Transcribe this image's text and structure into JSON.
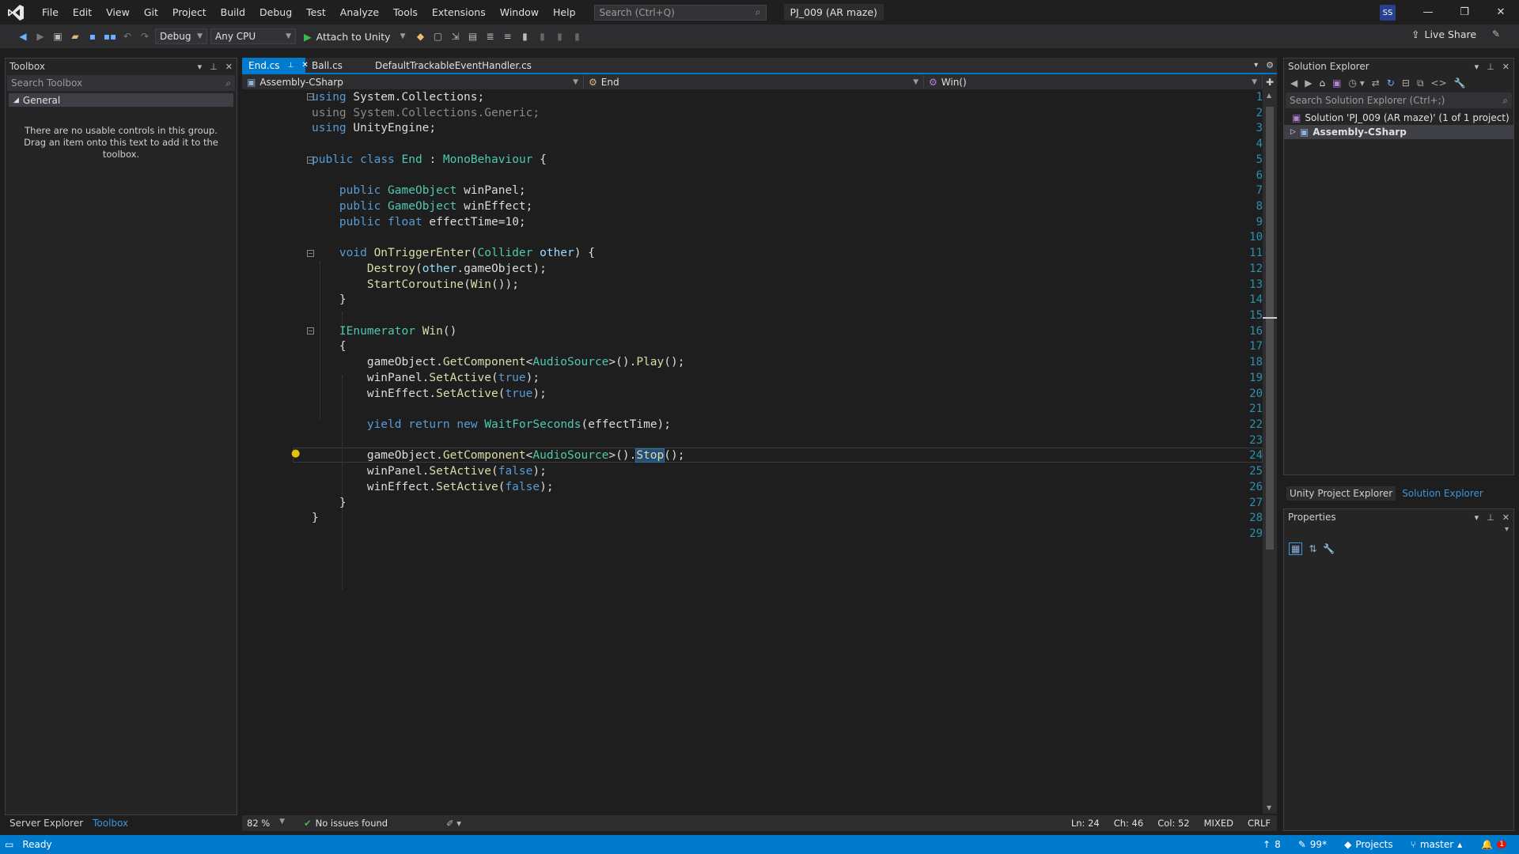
{
  "menu": [
    "File",
    "Edit",
    "View",
    "Git",
    "Project",
    "Build",
    "Debug",
    "Test",
    "Analyze",
    "Tools",
    "Extensions",
    "Window",
    "Help"
  ],
  "search": {
    "placeholder": "Search (Ctrl+Q)"
  },
  "solution_name": "PJ_009 (AR maze)",
  "user_initials": "SS",
  "toolbar": {
    "config": "Debug",
    "platform": "Any CPU",
    "attach": "Attach to Unity",
    "live_share": "Live Share"
  },
  "toolbox": {
    "title": "Toolbox",
    "search_placeholder": "Search Toolbox",
    "group": "General",
    "empty_message": "There are no usable controls in this group. Drag an item onto this text to add it to the toolbox."
  },
  "left_tabs": {
    "server_explorer": "Server Explorer",
    "toolbox": "Toolbox"
  },
  "editor": {
    "tabs": [
      {
        "label": "End.cs",
        "active": true
      },
      {
        "label": "Ball.cs",
        "active": false
      },
      {
        "label": "DefaultTrackableEventHandler.cs",
        "active": false
      }
    ],
    "nav": {
      "project": "Assembly-CSharp",
      "type": "End",
      "member": "Win()"
    },
    "zoom": "82 %",
    "issues": "No issues found",
    "position": {
      "ln": "Ln: 24",
      "ch": "Ch: 46",
      "col": "Col: 52",
      "mode": "MIXED",
      "eol": "CRLF"
    }
  },
  "solution_explorer": {
    "title": "Solution Explorer",
    "search_placeholder": "Search Solution Explorer (Ctrl+;)",
    "solution_row": "Solution 'PJ_009 (AR maze)' (1 of 1 project)",
    "project_row": "Assembly-CSharp"
  },
  "right_tabs": {
    "unity": "Unity Project Explorer",
    "solution": "Solution Explorer"
  },
  "properties": {
    "title": "Properties"
  },
  "statusbar": {
    "ready": "Ready",
    "up_count": "8",
    "pen_count": "99*",
    "projects": "Projects",
    "branch": "master",
    "notifications": "1"
  },
  "colors": {
    "accent": "#007acc",
    "keyword": "#569cd6",
    "type": "#4ec9b0",
    "method": "#dcdcaa",
    "linenumber": "#2b91af"
  }
}
